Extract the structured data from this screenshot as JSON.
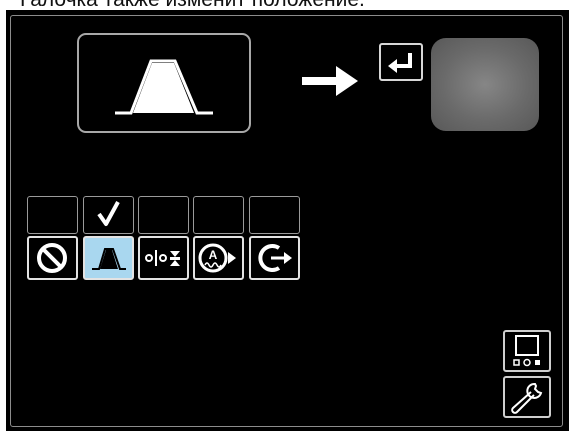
{
  "caption": "Галочка также изменит положение.",
  "main_panel": {
    "selected_function": "crater-function-icon",
    "arrow": "right-arrow-icon",
    "confirm": "enter-key-icon",
    "preview_tile": "gray-preview-tile"
  },
  "selection_row": {
    "checked_index": 1
  },
  "options": [
    {
      "icon": "disable-icon",
      "selected": false
    },
    {
      "icon": "crater-function-icon",
      "selected": true
    },
    {
      "icon": "spot-timer-icon",
      "selected": false
    },
    {
      "icon": "amperage-function-icon",
      "selected": false
    },
    {
      "icon": "restart-function-icon",
      "selected": false
    }
  ],
  "sidebar": {
    "buttons": [
      "display-settings-icon",
      "wrench-settings-icon"
    ]
  },
  "colors": {
    "screen_background": "#000000",
    "selected_option": "#a9d7ef",
    "border": "#d7d7d7"
  }
}
